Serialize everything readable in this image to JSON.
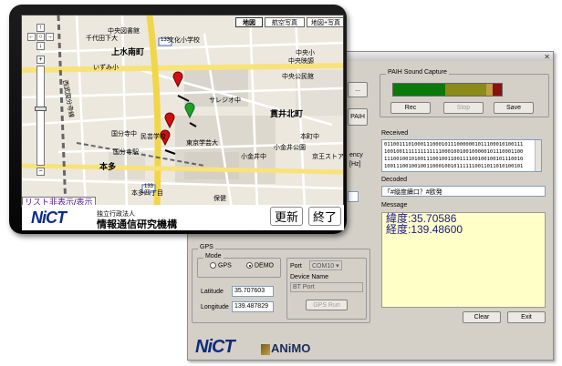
{
  "pc_app": {
    "sound_capture": {
      "title": "PAIH Sound Capture",
      "rec": "Rec",
      "stop": "Stop",
      "save": "Save"
    },
    "meter_colors": [
      "#8b0000",
      "#0a7a0a",
      "#8b8b1a",
      "#c0a040",
      "#8b1010"
    ],
    "received": {
      "title": "Received",
      "lines": [
        "0110011101000111000101110000001011100010100111",
        "1001001111111111111000100100100000101110001100",
        "1110010010100111001001100111100100100101110010",
        "1001110010010011000100101111110011011010100101"
      ]
    },
    "decoded": {
      "title": "Decoded",
      "value": "「#縦度續口？#欧発"
    },
    "message": {
      "title": "Message",
      "lines": [
        "緯度:35.70586",
        "経度:139.48600"
      ]
    },
    "clear": "Clear",
    "exit": "Exit",
    "side_buttons": [
      "...",
      "PAIH"
    ],
    "side_labels": [
      "ency",
      "[Hz]"
    ],
    "gps": {
      "title": "GPS",
      "mode_title": "Mode",
      "mode_options": [
        "GPS",
        "DEMO"
      ],
      "selected_mode": "DEMO",
      "port_label": "Port",
      "port_value": "COM10",
      "device_label": "Device Name",
      "device_value": "BT Port",
      "run": "GPS Run",
      "latitude_label": "Latitude",
      "latitude": "35.707603",
      "longitude_label": "Longitude",
      "longitude": "139.487829"
    },
    "logos": {
      "nict": "NiCT",
      "animo": "ANiMO"
    }
  },
  "device": {
    "map_tabs": [
      "地図",
      "航空写真",
      "地図+写真"
    ],
    "active_tab": "地図",
    "places": [
      "上水南町",
      "貫井北町",
      "本多",
      "中央図書館",
      "文化小学校",
      "東京学芸大",
      "小金井中",
      "国分寺駅",
      "サレジオ中",
      "中央公民館",
      "中央映謜",
      "小金井公園",
      "本町中",
      "民芸学校",
      "京王ストア",
      "西武国分寺線",
      "国分寺中",
      "千代田下大",
      "中央小",
      "保健",
      "本多四丁目",
      "いずみ小"
    ],
    "route_shields": [
      "133",
      "133"
    ],
    "list_link": {
      "toggle": "リスト非表示",
      "sep": "/",
      "show": "表示"
    },
    "org_line1": "独立行政法人",
    "org_line2": "情報通信研究機構",
    "logo": "NiCT",
    "update": "更新",
    "end": "終了",
    "zoom_glyphs": [
      "↑",
      "←",
      "○",
      "→",
      "↓",
      "+",
      "−"
    ],
    "pin_colors": [
      "#d01010",
      "#20a020"
    ]
  }
}
